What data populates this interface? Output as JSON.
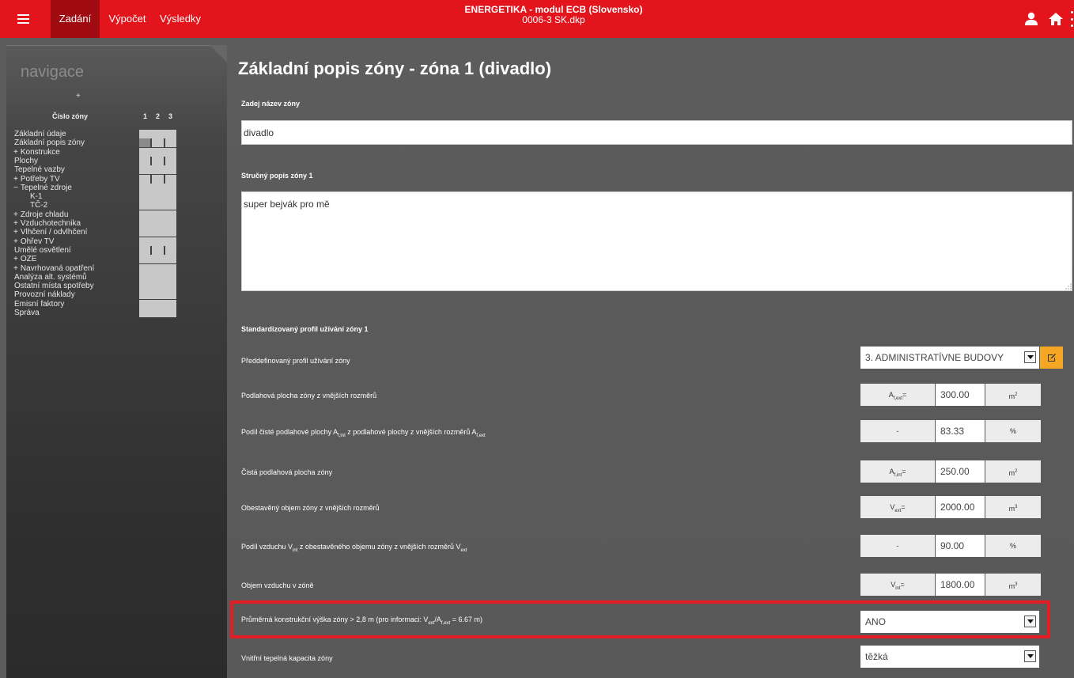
{
  "topbar": {
    "menu": [
      "Zadání",
      "Výpočet",
      "Výsledky"
    ],
    "active_index": 0,
    "title_line1": "ENERGETIKA - modul ECB (Slovensko)",
    "title_line2": "0006-3 SK.dkp",
    "accent_color": "#e3141b",
    "icons": [
      "menu-icon",
      "user-icon",
      "home-icon",
      "kebab-icon"
    ]
  },
  "nav": {
    "title": "navigace",
    "plus": "+",
    "zone_header": "Číslo zóny",
    "zone_numbers": [
      "1",
      "2",
      "3"
    ],
    "items": [
      {
        "sign": "",
        "label": "Základní údaje",
        "sub": false,
        "zones": 1
      },
      {
        "sign": "",
        "label": "Základní popis zóny",
        "sub": false,
        "zones": 3
      },
      {
        "sign": "+",
        "label": "Konstrukce",
        "sub": false,
        "zones": 1
      },
      {
        "sign": "",
        "label": "Plochy",
        "sub": false,
        "zones": 3
      },
      {
        "sign": "",
        "label": "Tepelné vazby",
        "sub": false,
        "zones": 1
      },
      {
        "sign": "+",
        "label": "Potřeby TV",
        "sub": false,
        "zones": 3
      },
      {
        "sign": "−",
        "label": "Tepelné zdroje",
        "sub": false,
        "zones": 1
      },
      {
        "sign": "",
        "label": "K-1",
        "sub": true,
        "zones": 1
      },
      {
        "sign": "",
        "label": "TČ-2",
        "sub": true,
        "zones": 1
      },
      {
        "sign": "+",
        "label": "Zdroje chladu",
        "sub": false,
        "zones": 1
      },
      {
        "sign": "+",
        "label": "Vzduchotechnika",
        "sub": false,
        "zones": 1
      },
      {
        "sign": "+",
        "label": "Vlhčení / odvlhčení",
        "sub": false,
        "zones": 1
      },
      {
        "sign": "+",
        "label": "Ohřev TV",
        "sub": false,
        "zones": 1
      },
      {
        "sign": "",
        "label": "Umělé osvětlení",
        "sub": false,
        "zones": 3
      },
      {
        "sign": "+",
        "label": "OZE",
        "sub": false,
        "zones": 1
      },
      {
        "sign": "+",
        "label": "Navrhovaná opatření",
        "sub": false,
        "zones": 1
      },
      {
        "sign": "",
        "label": "Analýza alt. systémů",
        "sub": false,
        "zones": 1
      },
      {
        "sign": "",
        "label": "Ostatní místa spotřeby",
        "sub": false,
        "zones": 1
      },
      {
        "sign": "",
        "label": "Provozní náklady",
        "sub": false,
        "zones": 1
      },
      {
        "sign": "",
        "label": "Emisní faktory",
        "sub": false,
        "zones": 1
      },
      {
        "sign": "",
        "label": "Správa",
        "sub": false,
        "zones": 1
      }
    ]
  },
  "main": {
    "title": "Základní popis zóny - zóna 1 (divadlo)",
    "name_label": "Zadej název zóny",
    "name_value": "divadlo",
    "desc_label": "Stručný popis zóny 1",
    "desc_value": "super bejvák pro mě",
    "profile_section": "Standardizovaný profil užívání zóny 1",
    "profile_label": "Předdefinovaný profil užívání zóny",
    "profile_value": "3. ADMINISTRATÍVNE BUDOVY",
    "rows": [
      {
        "label_html": "Podlahová plocha zóny z vnějších rozměrů",
        "sym_html": "A<sub>f,ext</sub>=",
        "value": "300.00",
        "unit_html": "m<sup>2</sup>"
      },
      {
        "label_html": "Podíl čisté podlahové plochy A<sub>f,int</sub> z podlahové plochy z vnějších rozměrů A<sub>f,ext</sub>",
        "sym_html": "-",
        "value": "83.33",
        "unit_html": "%"
      },
      {
        "label_html": "Čistá podlahová plocha zóny",
        "sym_html": "A<sub>f,int</sub>=",
        "value": "250.00",
        "unit_html": "m<sup>2</sup>"
      },
      {
        "label_html": "Obestavěný objem zóny z vnějších rozměrů",
        "sym_html": "V<sub>ext</sub>=",
        "value": "2000.00",
        "unit_html": "m<sup>3</sup>"
      },
      {
        "label_html": "Podíl vzduchu V<sub>int</sub> z obestavěného objemu zóny z vnějších rozměrů V<sub>ext</sub>",
        "sym_html": "-",
        "value": "90.00",
        "unit_html": "%"
      },
      {
        "label_html": "Objem vzduchu v zóně",
        "sym_html": "V<sub>int</sub>=",
        "value": "1800.00",
        "unit_html": "m<sup>3</sup>"
      }
    ],
    "height_label_html": "Průměrná konstrukční výška zóny &gt; 2,8 m (pro informaci: V<sub>ext</sub>/A<sub>f,ext</sub> = 6.67 m)",
    "height_value": "ANO",
    "capacity_label": "Vnitřní tepelná kapacita zóny",
    "capacity_value": "těžká",
    "highlight_color": "#e51d24",
    "edit_button_color": "#f5a623"
  }
}
